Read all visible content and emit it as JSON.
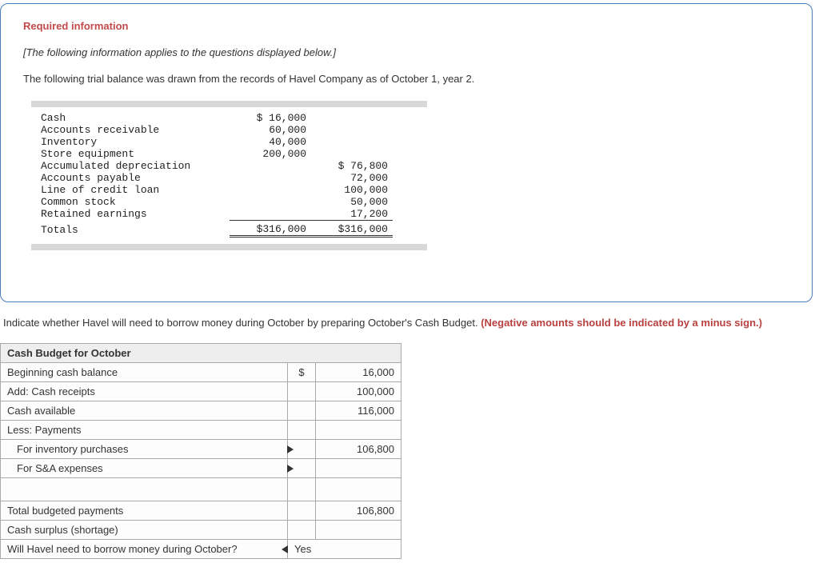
{
  "header": {
    "required": "Required information",
    "italic": "[The following information applies to the questions displayed below.]",
    "intro": "The following trial balance was drawn from the records of Havel Company as of October 1, year 2."
  },
  "trial_balance": {
    "rows": [
      {
        "label": "Cash",
        "debit": "$ 16,000",
        "credit": ""
      },
      {
        "label": "Accounts receivable",
        "debit": "60,000",
        "credit": ""
      },
      {
        "label": "Inventory",
        "debit": "40,000",
        "credit": ""
      },
      {
        "label": "Store equipment",
        "debit": "200,000",
        "credit": ""
      },
      {
        "label": "Accumulated depreciation",
        "debit": "",
        "credit": "$ 76,800"
      },
      {
        "label": "Accounts payable",
        "debit": "",
        "credit": "72,000"
      },
      {
        "label": "Line of credit loan",
        "debit": "",
        "credit": "100,000"
      },
      {
        "label": "Common stock",
        "debit": "",
        "credit": "50,000"
      },
      {
        "label": "Retained earnings",
        "debit": "",
        "credit": "17,200"
      }
    ],
    "totals": {
      "label": "Totals",
      "debit": "$316,000",
      "credit": "$316,000"
    }
  },
  "instruction": {
    "text": "Indicate whether Havel will need to borrow money during October by preparing October's Cash Budget. ",
    "note": "(Negative amounts should be indicated by a minus sign.)"
  },
  "budget": {
    "title": "Cash Budget for October",
    "rows": {
      "beg_bal": {
        "label": "Beginning cash balance",
        "sym": "$",
        "val": "16,000"
      },
      "add_rec": {
        "label": "Add: Cash receipts",
        "sym": "",
        "val": "100,000"
      },
      "cash_avail": {
        "label": "Cash available",
        "sym": "",
        "val": "116,000"
      },
      "less_pay": {
        "label": "Less: Payments",
        "sym": "",
        "val": ""
      },
      "inv_pur": {
        "label": "For inventory purchases",
        "sym": "",
        "val": "106,800"
      },
      "sae": {
        "label": "For S&A expenses",
        "sym": "",
        "val": ""
      },
      "blank": {
        "label": "",
        "sym": "",
        "val": ""
      },
      "tot_bud": {
        "label": "Total budgeted payments",
        "sym": "",
        "val": "106,800"
      },
      "surplus": {
        "label": "Cash surplus (shortage)",
        "sym": "",
        "val": ""
      },
      "borrow_q": {
        "label": "Will Havel need to borrow money during October?",
        "val": "Yes"
      }
    }
  }
}
